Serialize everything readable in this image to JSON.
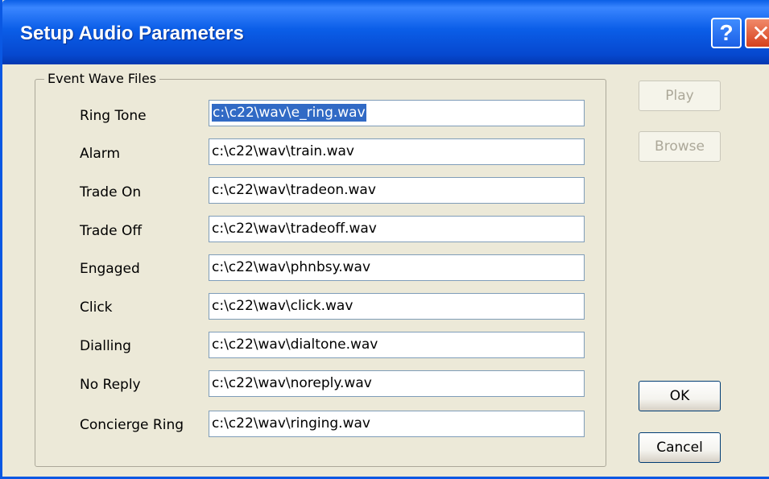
{
  "window": {
    "title": "Setup Audio Parameters",
    "help_glyph": "?",
    "close_glyph": "✕"
  },
  "group": {
    "label": "Event Wave Files"
  },
  "events": [
    {
      "label": "Ring Tone",
      "value": "c:\\c22\\wav\\e_ring.wav"
    },
    {
      "label": "Alarm",
      "value": "c:\\c22\\wav\\train.wav"
    },
    {
      "label": "Trade On",
      "value": "c:\\c22\\wav\\tradeon.wav"
    },
    {
      "label": "Trade Off",
      "value": "c:\\c22\\wav\\tradeoff.wav"
    },
    {
      "label": "Engaged",
      "value": "c:\\c22\\wav\\phnbsy.wav"
    },
    {
      "label": "Click",
      "value": "c:\\c22\\wav\\click.wav"
    },
    {
      "label": "Dialling",
      "value": "c:\\c22\\wav\\dialtone.wav"
    },
    {
      "label": "No Reply",
      "value": "c:\\c22\\wav\\noreply.wav"
    },
    {
      "label": "Concierge Ring",
      "value": "c:\\c22\\wav\\ringing.wav"
    }
  ],
  "buttons": {
    "play": "Play",
    "browse": "Browse",
    "ok": "OK",
    "cancel": "Cancel"
  },
  "colors": {
    "titlebar": "#0a5fe6",
    "selection": "#316ac5",
    "dialog_bg": "#ece9d8"
  }
}
